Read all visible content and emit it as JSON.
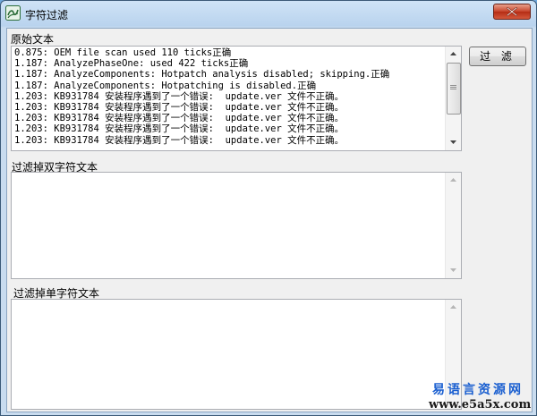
{
  "window": {
    "title": "字符过滤"
  },
  "labels": {
    "original": "原始文本",
    "double": "过滤掉双字符文本",
    "single": "过滤掉单字符文本"
  },
  "button": {
    "filter": "过 滤"
  },
  "original_lines": [
    "0.875: OEM file scan used 110 ticks正确",
    "1.187: AnalyzePhaseOne: used 422 ticks正确",
    "1.187: AnalyzeComponents: Hotpatch analysis disabled; skipping.正确",
    "1.187: AnalyzeComponents: Hotpatching is disabled.正确",
    "1.203: KB931784 安装程序遇到了一个错误:  update.ver 文件不正确。",
    "1.203: KB931784 安装程序遇到了一个错误:  update.ver 文件不正确。",
    "1.203: KB931784 安装程序遇到了一个错误:  update.ver 文件不正确。",
    "1.203: KB931784 安装程序遇到了一个错误:  update.ver 文件不正确。",
    "1.203: KB931784 安装程序遇到了一个错误:  update.ver 文件不正确。"
  ],
  "double_text": "",
  "single_text": "",
  "watermark": {
    "line1": "易语言资源网",
    "line2": "www.e5a5x.com"
  },
  "icons": {
    "app": "text-filter-icon",
    "close": "close-icon"
  }
}
